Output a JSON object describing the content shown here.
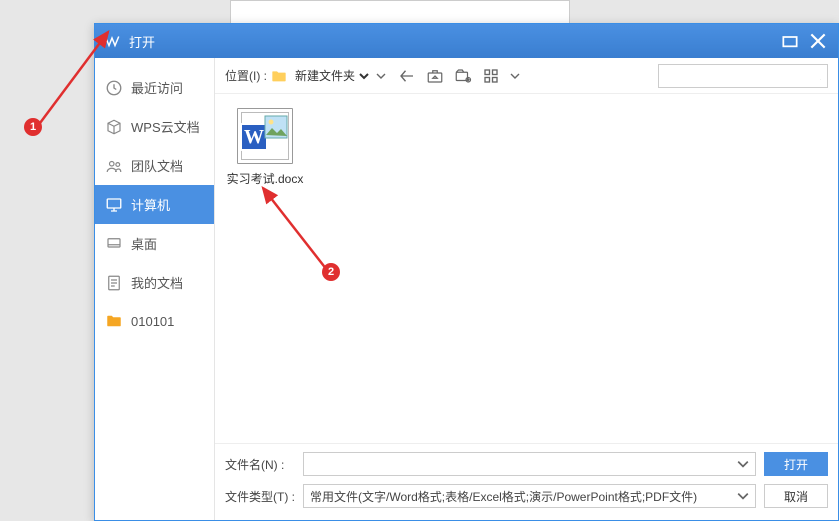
{
  "window": {
    "title": "打开"
  },
  "sidebar": {
    "items": [
      {
        "label": "最近访问"
      },
      {
        "label": "WPS云文档"
      },
      {
        "label": "团队文档"
      },
      {
        "label": "计算机"
      },
      {
        "label": "桌面"
      },
      {
        "label": "我的文档"
      },
      {
        "label": "010101"
      }
    ],
    "active_index": 3
  },
  "toolbar": {
    "location_label": "位置(I) :",
    "location_value": "新建文件夹"
  },
  "files": [
    {
      "name": "实习考试.docx"
    }
  ],
  "footer": {
    "filename_label": "文件名(N) :",
    "filename_value": "",
    "filetype_label": "文件类型(T) :",
    "filetype_value": "常用文件(文字/Word格式;表格/Excel格式;演示/PowerPoint格式;PDF文件)",
    "open_label": "打开",
    "cancel_label": "取消"
  },
  "annotations": {
    "badge1": "1",
    "badge2": "2"
  }
}
